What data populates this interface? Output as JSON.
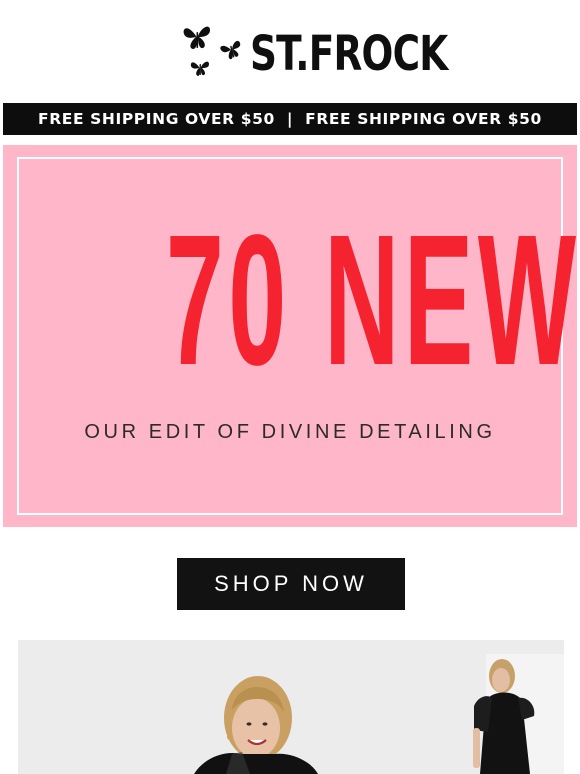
{
  "brand": {
    "name": "ST.FROCK",
    "logo_icon": "butterflies-icon"
  },
  "shipping_bar": {
    "left_text": "FREE SHIPPING OVER $50",
    "separator": "|",
    "right_text": "FREE SHIPPING OVER $50"
  },
  "promo": {
    "headline": "70 NEW",
    "subheadline": "OUR EDIT OF DIVINE DETAILING",
    "background_color": "#ffb6c8",
    "headline_color": "#f5222f"
  },
  "cta": {
    "label": "SHOP NOW"
  },
  "hero_image": {
    "description_icon": "model-photo"
  }
}
